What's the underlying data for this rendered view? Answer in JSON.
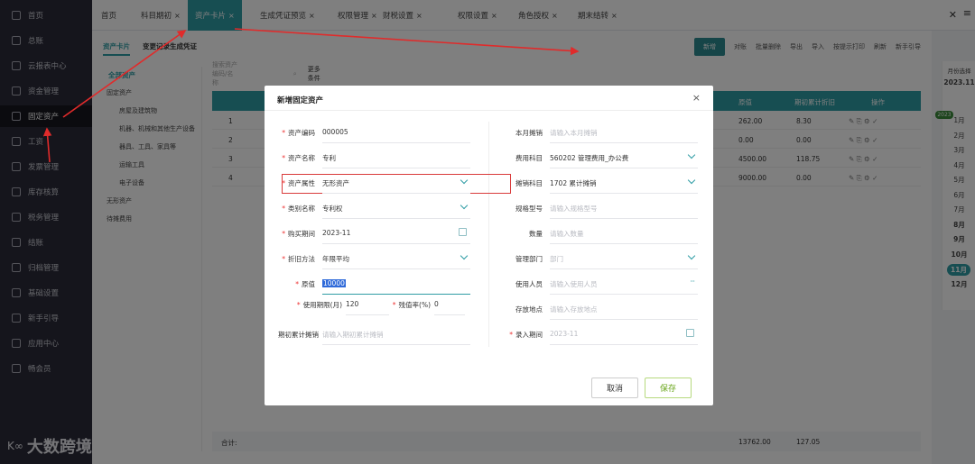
{
  "sidebar": {
    "items": [
      {
        "label": "首页",
        "icon": "home-icon"
      },
      {
        "label": "总账",
        "icon": "ledger-icon"
      },
      {
        "label": "云报表中心",
        "icon": "chart-icon"
      },
      {
        "label": "资金管理",
        "icon": "wallet-icon"
      },
      {
        "label": "固定资产",
        "icon": "asset-icon",
        "active": true
      },
      {
        "label": "工资",
        "icon": "salary-icon"
      },
      {
        "label": "发票管理",
        "icon": "invoice-icon"
      },
      {
        "label": "库存核算",
        "icon": "inventory-icon"
      },
      {
        "label": "税务管理",
        "icon": "tax-icon"
      },
      {
        "label": "结账",
        "icon": "close-books-icon"
      },
      {
        "label": "归档管理",
        "icon": "archive-icon"
      },
      {
        "label": "基础设置",
        "icon": "settings-icon"
      },
      {
        "label": "新手引导",
        "icon": "guide-icon"
      },
      {
        "label": "应用中心",
        "icon": "apps-icon"
      },
      {
        "label": "畅会员",
        "icon": "vip-icon"
      }
    ],
    "logo": "大数跨境",
    "logo_mark": "K∞"
  },
  "tabs": [
    {
      "label": "首页",
      "closable": false
    },
    {
      "label": "科目期初",
      "closable": true
    },
    {
      "label": "资产卡片",
      "closable": true,
      "active": true
    },
    {
      "label": "生成凭证预览",
      "closable": true
    },
    {
      "label": "权限管理",
      "closable": true
    },
    {
      "label": "财税设置",
      "closable": true
    },
    {
      "label": "权限设置",
      "closable": true
    },
    {
      "label": "角色授权",
      "closable": true
    },
    {
      "label": "期末结转",
      "closable": true
    }
  ],
  "tab_close_all": "✕",
  "tab_menu": "≡",
  "page": {
    "subtabs": [
      "资产卡片",
      "变更记录生成凭证"
    ],
    "toolbar": [
      "新增",
      "对账",
      "批量删除",
      "导出",
      "导入",
      "按提示打印",
      "刷新",
      "新手引导"
    ],
    "tree_title": "全部资产",
    "tree": [
      "固定资产",
      "房屋及建筑物",
      "机器、机械和其他生产设备",
      "器具、工具、家具等",
      "运输工具",
      "电子设备",
      "无形资产",
      "待摊费用"
    ],
    "search_placeholder": "搜索资产编码/名称",
    "more_filters": "更多条件",
    "table_headers": [
      "原值",
      "期初累计折旧",
      "操作"
    ],
    "rows": [
      {
        "no": "1",
        "value": "262.00",
        "dep": "8.30"
      },
      {
        "no": "2",
        "value": "0.00",
        "dep": "0.00"
      },
      {
        "no": "3",
        "value": "4500.00",
        "dep": "118.75"
      },
      {
        "no": "4",
        "value": "9000.00",
        "dep": "0.00"
      }
    ],
    "total_label": "合计:",
    "total_value": "13762.00",
    "total_dep": "127.05"
  },
  "month_panel": {
    "title": "月份选择",
    "year": "2023.11",
    "badge": "2023",
    "months": [
      "1月",
      "2月",
      "3月",
      "4月",
      "5月",
      "6月",
      "7月",
      "8月",
      "9月",
      "10月",
      "11月",
      "12月"
    ],
    "current": "11月"
  },
  "modal": {
    "title": "新增固定资产",
    "close": "×",
    "left": [
      {
        "label": "资产编码",
        "required": true,
        "value": "000005"
      },
      {
        "label": "资产名称",
        "required": true,
        "value": "专利"
      },
      {
        "label": "资产属性",
        "required": true,
        "value": "无形资产",
        "select": true
      },
      {
        "label": "类别名称",
        "required": true,
        "value": "专利权",
        "select": true
      },
      {
        "label": "购买期间",
        "required": true,
        "value": "2023-11",
        "calendar": true
      },
      {
        "label": "折旧方法",
        "required": true,
        "value": "年限平均",
        "select": true
      },
      {
        "label": "原值",
        "required": true,
        "value": "10000"
      }
    ],
    "life_label": "使用期限(月)",
    "life_value": "120",
    "residual_label": "残值率(%)",
    "residual_value": "0",
    "opening_label": "期初累计摊销",
    "opening_placeholder": "请输入期初累计摊销",
    "right": [
      {
        "label": "本月摊销",
        "placeholder": "请输入本月摊销"
      },
      {
        "label": "费用科目",
        "value": "560202 管理费用_办公费",
        "select": true
      },
      {
        "label": "摊销科目",
        "value": "1702 累计摊销",
        "select": true
      },
      {
        "label": "规格型号",
        "placeholder": "请输入规格型号"
      },
      {
        "label": "数量",
        "placeholder": "请输入数量"
      },
      {
        "label": "管理部门",
        "placeholder": "部门",
        "select": true
      },
      {
        "label": "使用人员",
        "placeholder": "请输入使用人员",
        "more": true
      },
      {
        "label": "存放地点",
        "placeholder": "请输入存放地点"
      },
      {
        "label": "录入期间",
        "required": true,
        "value": "2023-11",
        "calendar": true,
        "disabled": true
      }
    ],
    "cancel": "取消",
    "save": "保存"
  },
  "colors": {
    "accent": "#2f9ca4",
    "highlight": "#d93a3a",
    "sidebar": "#2b2b38"
  }
}
